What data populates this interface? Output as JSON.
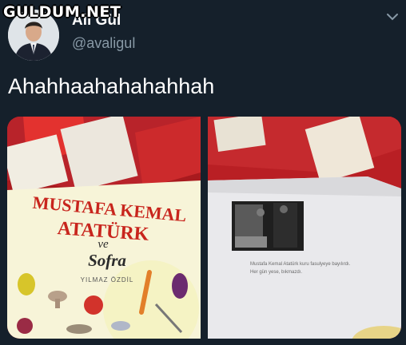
{
  "watermark": {
    "text": "GULDUM.NET"
  },
  "user": {
    "display_name": "Ali Gül",
    "handle": "@avaligul"
  },
  "tweet": {
    "text": "Ahahhaahahahahhah"
  },
  "book_cover": {
    "title_line1": "MUSTAFA KEMAL",
    "title_line2": "ATATÜRK",
    "connector": "ve",
    "subtitle": "Sofra",
    "author": "YILMAZ ÖZDİL"
  },
  "book_page": {
    "caption_line1": "Mustafa Kemal Atatürk kuru fasulyeye bayılırdı.",
    "caption_line2": "Her gün yese, bıkmazdı."
  },
  "icons": [
    "avatar",
    "chevron-down-icon"
  ],
  "colors": {
    "background": "#15202b",
    "handle": "#8899a6",
    "title_red": "#c8251d",
    "shelf_red": "#b51e22"
  }
}
